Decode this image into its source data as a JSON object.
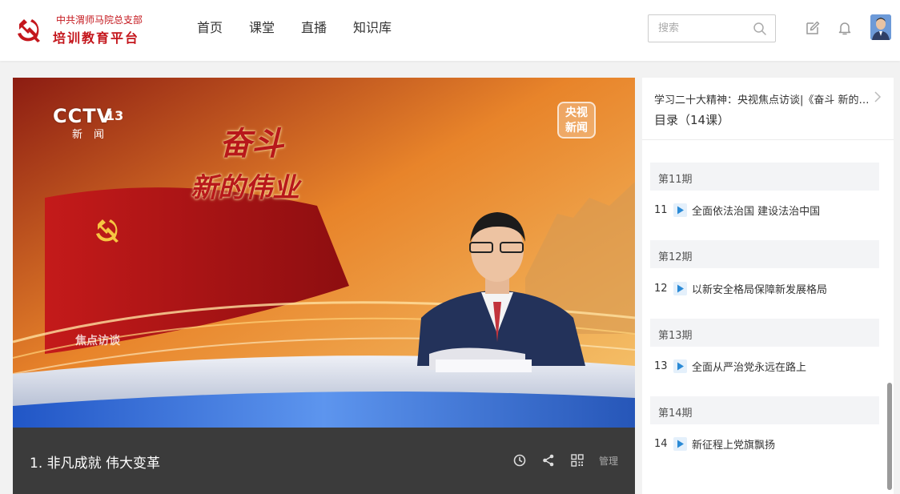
{
  "brand": {
    "org": "中共渭师马院总支部",
    "platform": "培训教育平台",
    "color": "#c4161c"
  },
  "nav": {
    "items": [
      {
        "label": "首页"
      },
      {
        "label": "课堂"
      },
      {
        "label": "直播"
      },
      {
        "label": "知识库"
      }
    ]
  },
  "search": {
    "placeholder": "搜索",
    "value": ""
  },
  "header_icons": [
    "edit-icon",
    "bell-icon",
    "avatar"
  ],
  "video": {
    "channel": "CCTV",
    "channel_number": "13",
    "channel_sub": "新闻",
    "corner_badge_line1": "央视",
    "corner_badge_line2": "新闻",
    "show_title_line1": "奋斗",
    "show_title_line2": "新的伟业",
    "show_badge": "焦点访谈"
  },
  "player_bar": {
    "lesson_title": "1. 非凡成就 伟大变革",
    "icons": [
      "clock-icon",
      "share-icon",
      "qrcode-icon"
    ],
    "manage_label": "管理"
  },
  "sidebar": {
    "course_title": "学习二十大精神：央视焦点访谈|《奋斗 新的伟业》",
    "catalog_title": "目录（14课）",
    "periods": [
      {
        "label": "第11期",
        "num": "11",
        "lesson": "全面依法治国 建设法治中国"
      },
      {
        "label": "第12期",
        "num": "12",
        "lesson": "以新安全格局保障新发展格局"
      },
      {
        "label": "第13期",
        "num": "13",
        "lesson": "全面从严治党永远在路上"
      },
      {
        "label": "第14期",
        "num": "14",
        "lesson": "新征程上党旗飘扬"
      }
    ],
    "play_icon_color": "#2a8ad6"
  }
}
